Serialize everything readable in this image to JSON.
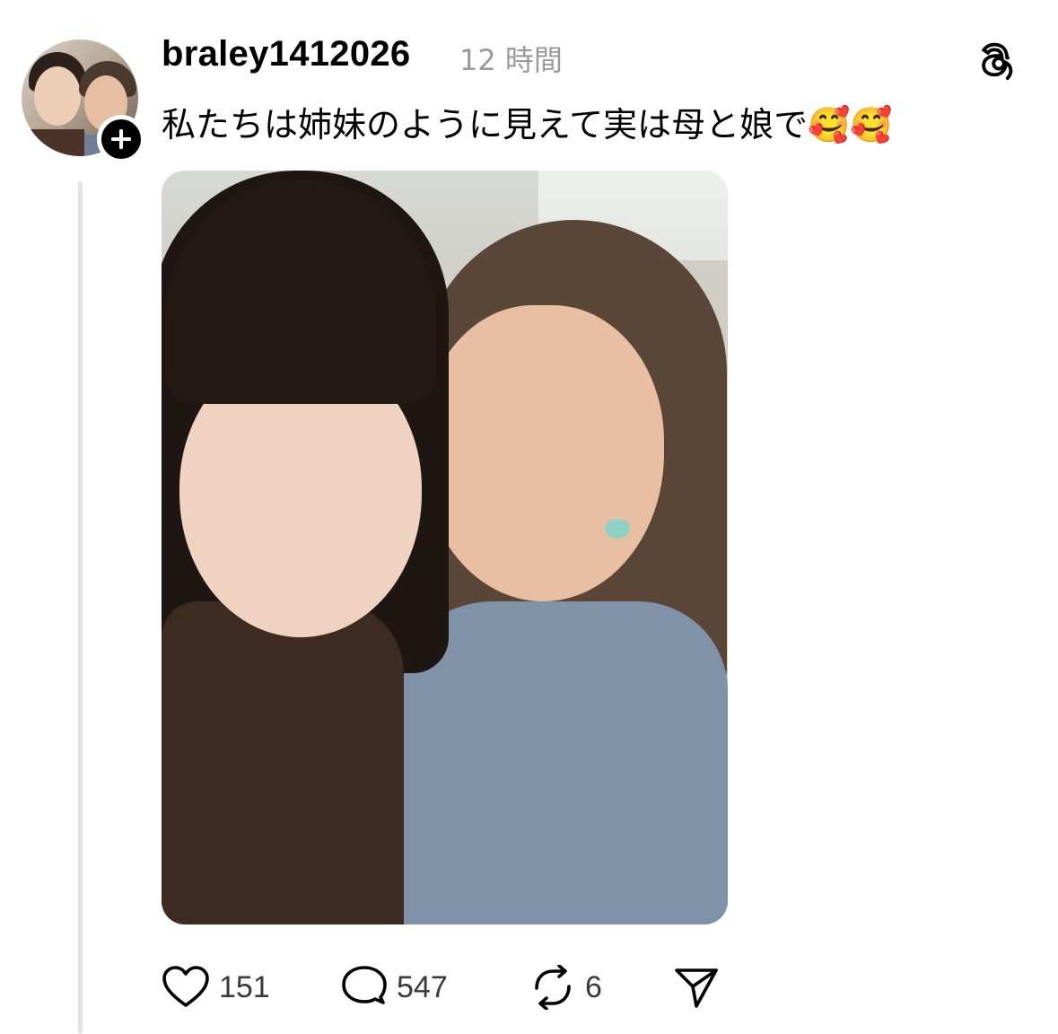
{
  "post": {
    "username": "braley1412026",
    "timestamp": "12 時間",
    "text": "私たちは姉妹のように見えて実は母と娘で🥰🥰"
  },
  "actions": {
    "likes": "151",
    "replies": "547",
    "reposts": "6"
  },
  "icons": {
    "follow": "plus-icon",
    "app_logo": "threads-logo-icon",
    "like": "heart-icon",
    "reply": "comment-icon",
    "repost": "repost-icon",
    "share": "send-icon"
  }
}
